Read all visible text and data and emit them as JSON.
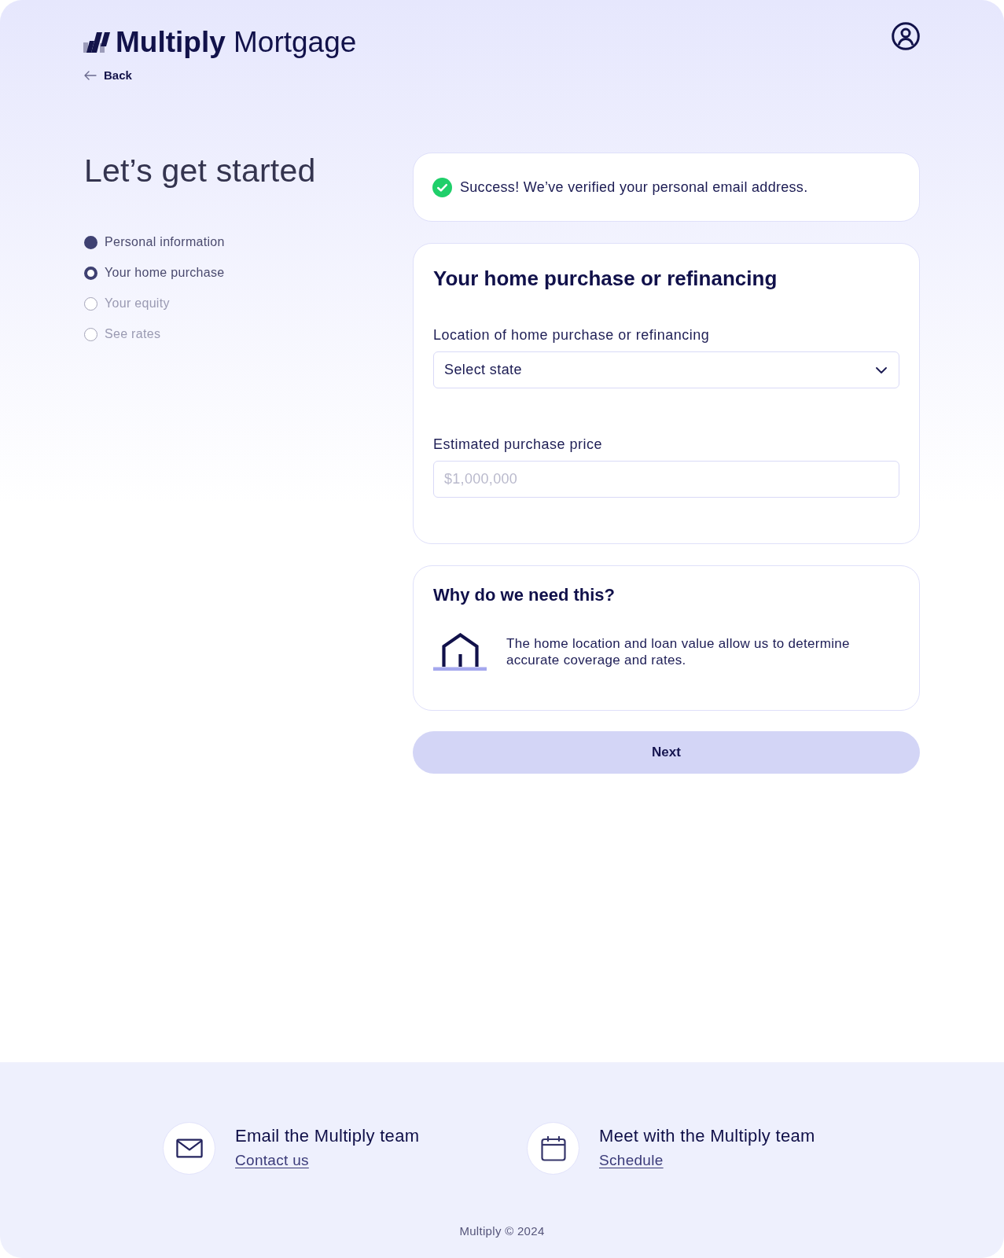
{
  "header": {
    "brand": "**Multiply** Mortgage",
    "back_link": "Back"
  },
  "sidebar": {
    "title": "Let’s get started",
    "steps": [
      {
        "label": "Personal information",
        "completed": true,
        "selected": false
      },
      {
        "label": "Your home purchase",
        "completed": false,
        "selected": true
      },
      {
        "label": "Your equity",
        "completed": false,
        "selected": false
      },
      {
        "label": "See rates",
        "completed": false,
        "selected": false
      }
    ]
  },
  "notice": {
    "kind": "success",
    "text": "Success! We’ve verified your personal email address."
  },
  "form": {
    "title": "Your home purchase or refinancing",
    "fields": [
      {
        "kind": "select",
        "label": "Location of home purchase or refinancing",
        "value": "Select state"
      },
      {
        "kind": "text",
        "label": "Estimated purchase price",
        "placeholder": "$1,000,000"
      }
    ]
  },
  "info": {
    "title": "Why do we need this?",
    "text": "The home location and loan value allow us to determine accurate coverage and rates."
  },
  "next_button": "Next",
  "footer": {
    "contacts": [
      {
        "kind": "email",
        "title": "Email the Multiply team",
        "link": "Contact us"
      },
      {
        "kind": "calendar",
        "title": "Meet with the Multiply team",
        "link": "Schedule"
      }
    ],
    "copyright": "Multiply © 2024"
  }
}
